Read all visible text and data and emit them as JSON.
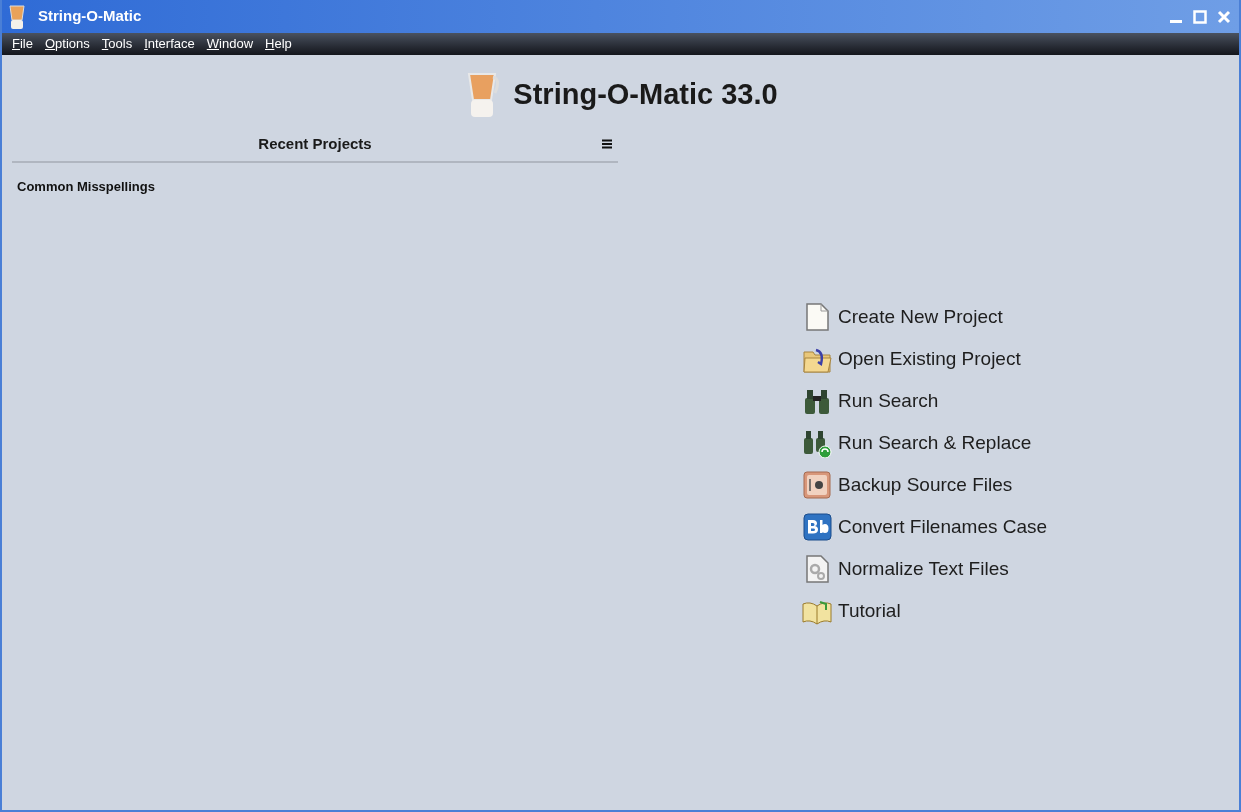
{
  "window": {
    "title": "String-O-Matic"
  },
  "menu": [
    "File",
    "Options",
    "Tools",
    "Interface",
    "Window",
    "Help"
  ],
  "heading": "String-O-Matic 33.0",
  "recent_projects": {
    "title": "Recent Projects",
    "items": [
      "Common Misspellings"
    ]
  },
  "actions": [
    {
      "kind": "new",
      "label": "Create New Project"
    },
    {
      "kind": "open",
      "label": "Open Existing Project"
    },
    {
      "kind": "search",
      "label": "Run Search"
    },
    {
      "kind": "replace",
      "label": "Run Search & Replace"
    },
    {
      "kind": "backup",
      "label": "Backup Source Files"
    },
    {
      "kind": "case",
      "label": "Convert Filenames Case"
    },
    {
      "kind": "normalize",
      "label": "Normalize Text Files"
    },
    {
      "kind": "tutorial",
      "label": "Tutorial"
    }
  ]
}
